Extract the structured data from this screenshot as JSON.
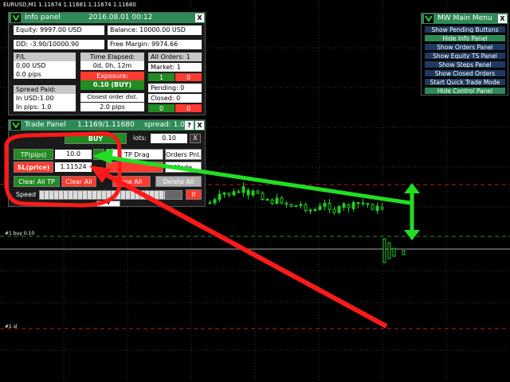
{
  "chart": {
    "title": "EURUSD,M1  1.11674 1.11681 1.11674 1.11680",
    "label_buy": "#1 buy 0.10",
    "label_sl": "#1 sl"
  },
  "info_panel": {
    "title": "Info panel",
    "datetime": "2016.08.01 00:12",
    "close": "X",
    "equity": "Equity: 9997.00 USD",
    "balance": "Balance: 10000.00 USD",
    "dd": "DD: -3.90/10000.90",
    "free_margin": "Free Margin: 9974.66",
    "pl_label": "P/L",
    "pl_usd": "0.00 USD",
    "pl_pips": "0.0 pips",
    "spread_label": "Spread Paid:",
    "spread_usd": "In USD:1.00",
    "spread_pips": "In pips: 1.0",
    "time_elapsed_label": "Time Elapsed:",
    "time_elapsed": "0d, 0h, 12m",
    "exposure_label": "Exposure:",
    "exposure": "0.10 (BUY)",
    "closest_label": "Closest order dist.",
    "closest": "2.0 pips",
    "all_orders": "All Orders: 1",
    "market": "Market: 1",
    "market_g": "1",
    "market_r": "0",
    "pending": "Pending: 0",
    "closed": "Closed: 0",
    "closed_g": "0",
    "closed_r": "0"
  },
  "trade_panel": {
    "title": "Trade Panel",
    "prices": "1.1169/1.11680",
    "spread": "spread: 1.0",
    "help": "?",
    "close": "X",
    "buy": "BUY",
    "lots_label": "lots:",
    "lots": "0.10",
    "lots_x": "X",
    "tp_label": "TP(pips)",
    "tp_value": "10.0",
    "tp_drag": "t TP Drag",
    "orders_pnl": "Orders Pnl.",
    "sl_label": "SL(price)",
    "sl_value": "1.11524",
    "mode": "Mode",
    "clear_all_tp": "Clear All TP",
    "clear_all": "Clear All",
    "close_all": "ose All",
    "delete_all": "Delete All",
    "speed_label": "Speed",
    "pause": "II",
    "expand": "▼"
  },
  "mw_menu": {
    "title": "MW Main Menu",
    "close": "X",
    "items": [
      "Show Pending Buttons",
      "Hide Info Panel",
      "Show Orders Panel",
      "Show Equity TS Panel",
      "Show Steps Panel",
      "Show Closed Orders",
      "Start Quick Trade Mode",
      "Hide Control Panel"
    ]
  },
  "colors": {
    "panel_title": "#2e8b57",
    "menu_item": "#1e3a5f",
    "red_arrow": "#ff1a1a",
    "green_arrow": "#22dd22"
  },
  "speed": {
    "level": 0.88
  }
}
